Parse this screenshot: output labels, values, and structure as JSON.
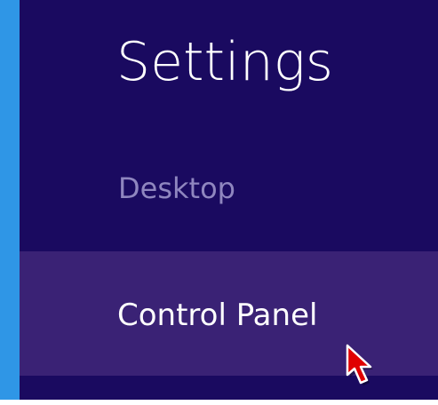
{
  "pane": {
    "title": "Settings",
    "section_header": "Desktop",
    "items": [
      {
        "label": "Control Panel",
        "state": "hover"
      }
    ]
  },
  "colors": {
    "pane_background": "#1a0a60",
    "accent_edge": "#2f96e6",
    "hover_background": "#3a2275",
    "section_header_text": "#8f86bf",
    "text": "#ffffff"
  },
  "cursor": {
    "icon": "arrow-pointer-icon"
  }
}
